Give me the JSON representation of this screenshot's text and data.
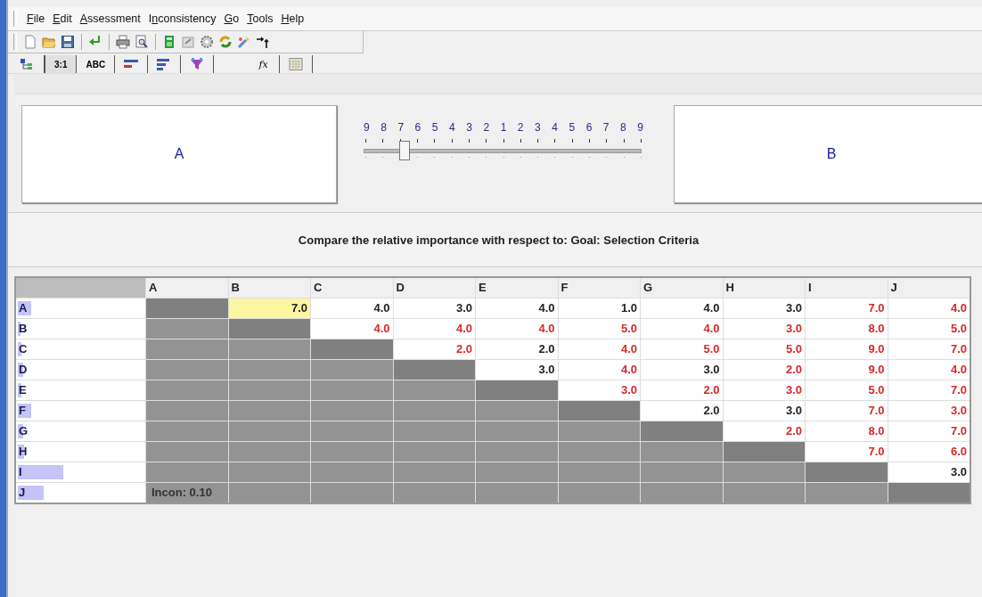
{
  "menu": [
    {
      "key": "F",
      "post": "ile"
    },
    {
      "key": "E",
      "post": "dit"
    },
    {
      "key": "A",
      "post": "ssessment"
    },
    {
      "pre": "I",
      "key": "n",
      "post": "consistency"
    },
    {
      "key": "G",
      "post": "o"
    },
    {
      "key": "T",
      "post": "ools"
    },
    {
      "key": "H",
      "post": "elp"
    }
  ],
  "tabs": [
    {
      "kind": "tree",
      "selected": false
    },
    {
      "kind": "text",
      "label": "3:1",
      "selected": true
    },
    {
      "kind": "text",
      "label": "ABC",
      "selected": false
    },
    {
      "kind": "bars",
      "selected": false
    },
    {
      "kind": "lines",
      "selected": false
    },
    {
      "kind": "funnel",
      "selected": false
    },
    {
      "kind": "formula",
      "label": "fx",
      "selected": false
    },
    {
      "kind": "grid",
      "selected": false
    }
  ],
  "left_element": "A",
  "right_element": "B",
  "scale": {
    "labels": [
      "9",
      "8",
      "7",
      "6",
      "5",
      "4",
      "3",
      "2",
      "1",
      "2",
      "3",
      "4",
      "5",
      "6",
      "7",
      "8",
      "9"
    ],
    "level": 0.125
  },
  "prompt": "Compare the relative importance with respect to: Goal: Selection Criteria",
  "matrix": {
    "columns": [
      "A",
      "B",
      "C",
      "D",
      "E",
      "F",
      "G",
      "H",
      "I",
      "J"
    ],
    "rows": [
      {
        "label": "A",
        "level": 0.1,
        "cells": [
          {
            "kind": "diagonal"
          },
          {
            "kind": "value",
            "value": "7.0",
            "inverse": false,
            "selected": true
          },
          {
            "kind": "value",
            "value": "4.0",
            "inverse": false,
            "selected": false
          },
          {
            "kind": "value",
            "value": "3.0",
            "inverse": false,
            "selected": false
          },
          {
            "kind": "value",
            "value": "4.0",
            "inverse": false,
            "selected": false
          },
          {
            "kind": "value",
            "value": "1.0",
            "inverse": false,
            "selected": false
          },
          {
            "kind": "value",
            "value": "4.0",
            "inverse": false,
            "selected": false
          },
          {
            "kind": "value",
            "value": "3.0",
            "inverse": false,
            "selected": false
          },
          {
            "kind": "value",
            "value": "7.0",
            "inverse": true,
            "selected": false
          },
          {
            "kind": "value",
            "value": "4.0",
            "inverse": true,
            "selected": false
          }
        ]
      },
      {
        "label": "B",
        "level": 0.02,
        "cells": [
          {
            "kind": "lower"
          },
          {
            "kind": "diagonal"
          },
          {
            "kind": "value",
            "value": "4.0",
            "inverse": true,
            "selected": false
          },
          {
            "kind": "value",
            "value": "4.0",
            "inverse": true,
            "selected": false
          },
          {
            "kind": "value",
            "value": "4.0",
            "inverse": true,
            "selected": false
          },
          {
            "kind": "value",
            "value": "5.0",
            "inverse": true,
            "selected": false
          },
          {
            "kind": "value",
            "value": "4.0",
            "inverse": true,
            "selected": false
          },
          {
            "kind": "value",
            "value": "3.0",
            "inverse": true,
            "selected": false
          },
          {
            "kind": "value",
            "value": "8.0",
            "inverse": true,
            "selected": false
          },
          {
            "kind": "value",
            "value": "5.0",
            "inverse": true,
            "selected": false
          }
        ]
      },
      {
        "label": "C",
        "level": 0.03,
        "cells": [
          {
            "kind": "lower"
          },
          {
            "kind": "lower"
          },
          {
            "kind": "diagonal"
          },
          {
            "kind": "value",
            "value": "2.0",
            "inverse": true,
            "selected": false
          },
          {
            "kind": "value",
            "value": "2.0",
            "inverse": false,
            "selected": false
          },
          {
            "kind": "value",
            "value": "4.0",
            "inverse": true,
            "selected": false
          },
          {
            "kind": "value",
            "value": "5.0",
            "inverse": true,
            "selected": false
          },
          {
            "kind": "value",
            "value": "5.0",
            "inverse": true,
            "selected": false
          },
          {
            "kind": "value",
            "value": "9.0",
            "inverse": true,
            "selected": false
          },
          {
            "kind": "value",
            "value": "7.0",
            "inverse": true,
            "selected": false
          }
        ]
      },
      {
        "label": "D",
        "level": 0.04,
        "cells": [
          {
            "kind": "lower"
          },
          {
            "kind": "lower"
          },
          {
            "kind": "lower"
          },
          {
            "kind": "diagonal"
          },
          {
            "kind": "value",
            "value": "3.0",
            "inverse": false,
            "selected": false
          },
          {
            "kind": "value",
            "value": "4.0",
            "inverse": true,
            "selected": false
          },
          {
            "kind": "value",
            "value": "3.0",
            "inverse": false,
            "selected": false
          },
          {
            "kind": "value",
            "value": "2.0",
            "inverse": true,
            "selected": false
          },
          {
            "kind": "value",
            "value": "9.0",
            "inverse": true,
            "selected": false
          },
          {
            "kind": "value",
            "value": "4.0",
            "inverse": true,
            "selected": false
          }
        ]
      },
      {
        "label": "E",
        "level": 0.03,
        "cells": [
          {
            "kind": "lower"
          },
          {
            "kind": "lower"
          },
          {
            "kind": "lower"
          },
          {
            "kind": "lower"
          },
          {
            "kind": "diagonal"
          },
          {
            "kind": "value",
            "value": "3.0",
            "inverse": true,
            "selected": false
          },
          {
            "kind": "value",
            "value": "2.0",
            "inverse": true,
            "selected": false
          },
          {
            "kind": "value",
            "value": "3.0",
            "inverse": true,
            "selected": false
          },
          {
            "kind": "value",
            "value": "5.0",
            "inverse": true,
            "selected": false
          },
          {
            "kind": "value",
            "value": "7.0",
            "inverse": true,
            "selected": false
          }
        ]
      },
      {
        "label": "F",
        "level": 0.1,
        "cells": [
          {
            "kind": "lower"
          },
          {
            "kind": "lower"
          },
          {
            "kind": "lower"
          },
          {
            "kind": "lower"
          },
          {
            "kind": "lower"
          },
          {
            "kind": "diagonal"
          },
          {
            "kind": "value",
            "value": "2.0",
            "inverse": false,
            "selected": false
          },
          {
            "kind": "value",
            "value": "3.0",
            "inverse": false,
            "selected": false
          },
          {
            "kind": "value",
            "value": "7.0",
            "inverse": true,
            "selected": false
          },
          {
            "kind": "value",
            "value": "3.0",
            "inverse": true,
            "selected": false
          }
        ]
      },
      {
        "label": "G",
        "level": 0.04,
        "cells": [
          {
            "kind": "lower"
          },
          {
            "kind": "lower"
          },
          {
            "kind": "lower"
          },
          {
            "kind": "lower"
          },
          {
            "kind": "lower"
          },
          {
            "kind": "lower"
          },
          {
            "kind": "diagonal"
          },
          {
            "kind": "value",
            "value": "2.0",
            "inverse": true,
            "selected": false
          },
          {
            "kind": "value",
            "value": "8.0",
            "inverse": true,
            "selected": false
          },
          {
            "kind": "value",
            "value": "7.0",
            "inverse": true,
            "selected": false
          }
        ]
      },
      {
        "label": "H",
        "level": 0.05,
        "cells": [
          {
            "kind": "lower"
          },
          {
            "kind": "lower"
          },
          {
            "kind": "lower"
          },
          {
            "kind": "lower"
          },
          {
            "kind": "lower"
          },
          {
            "kind": "lower"
          },
          {
            "kind": "lower"
          },
          {
            "kind": "diagonal"
          },
          {
            "kind": "value",
            "value": "7.0",
            "inverse": true,
            "selected": false
          },
          {
            "kind": "value",
            "value": "6.0",
            "inverse": true,
            "selected": false
          }
        ]
      },
      {
        "label": "I",
        "level": 0.35,
        "cells": [
          {
            "kind": "lower"
          },
          {
            "kind": "lower"
          },
          {
            "kind": "lower"
          },
          {
            "kind": "lower"
          },
          {
            "kind": "lower"
          },
          {
            "kind": "lower"
          },
          {
            "kind": "lower"
          },
          {
            "kind": "lower"
          },
          {
            "kind": "diagonal"
          },
          {
            "kind": "value",
            "value": "3.0",
            "inverse": false,
            "selected": false
          }
        ]
      },
      {
        "label": "J",
        "level": 0.2,
        "cells": [
          {
            "kind": "note",
            "text": "Incon: 0.10"
          },
          {
            "kind": "lower"
          },
          {
            "kind": "lower"
          },
          {
            "kind": "lower"
          },
          {
            "kind": "lower"
          },
          {
            "kind": "lower"
          },
          {
            "kind": "lower"
          },
          {
            "kind": "lower"
          },
          {
            "kind": "lower"
          },
          {
            "kind": "diagonal"
          }
        ]
      }
    ]
  }
}
